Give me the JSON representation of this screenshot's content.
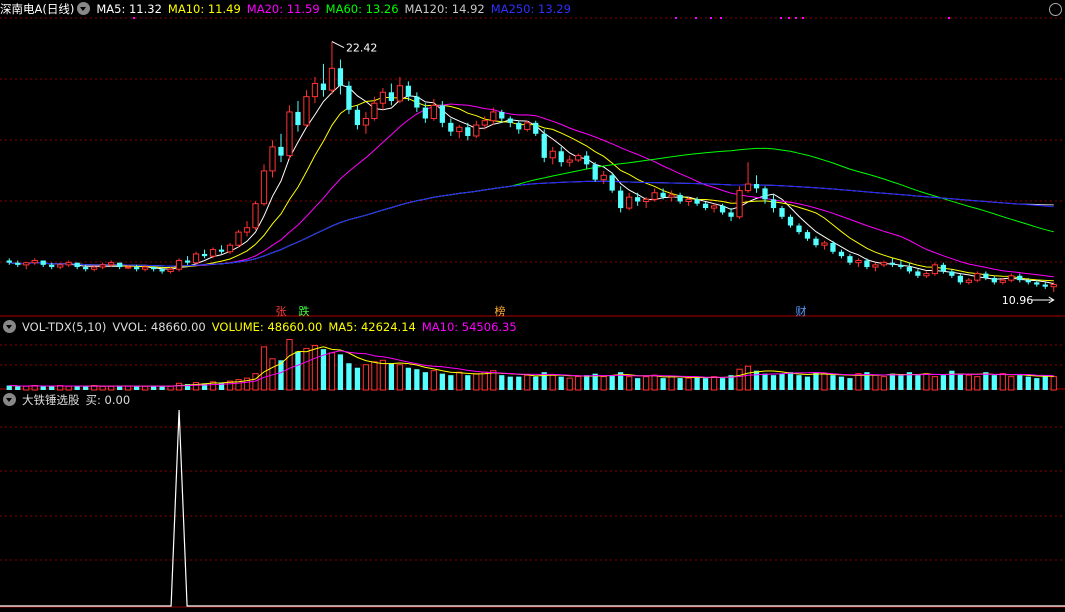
{
  "main_header": {
    "title": "深南电A(日线)",
    "ma5": "MA5: 11.32",
    "ma10": "MA10: 11.49",
    "ma20": "MA20: 11.59",
    "ma60": "MA60: 13.26",
    "ma120": "MA120: 14.92",
    "ma250": "MA250: 13.29"
  },
  "vol_header": {
    "name": "VOL-TDX(5,10)",
    "vvol": "VVOL: 48660.00",
    "volume": "VOLUME: 48660.00",
    "ma5": "MA5: 42624.14",
    "ma10": "MA10: 54506.35"
  },
  "ind_header": {
    "name": "大铁锤选股",
    "buy": "买: 0.00"
  },
  "price_labels": {
    "high": "22.42",
    "low": "10.96"
  },
  "markers": [
    "张",
    "跌",
    "榜",
    "财"
  ],
  "colors": {
    "up": "#ff3232",
    "down": "#54ffff",
    "ma5": "#ffffff",
    "ma10": "#ffff00",
    "ma20": "#ff00ff",
    "ma60": "#00ff00",
    "ma120": "#c8c8c8",
    "ma250": "#2020ff",
    "grid": "#8b0000",
    "magenta_dot": "#ff00ff"
  },
  "chart_data": {
    "type": "candlestick",
    "ohlc": [
      [
        12.4,
        12.5,
        12.2,
        12.3
      ],
      [
        12.3,
        12.4,
        12.1,
        12.2
      ],
      [
        12.2,
        12.3,
        12.0,
        12.3
      ],
      [
        12.3,
        12.5,
        12.2,
        12.4
      ],
      [
        12.4,
        12.4,
        12.1,
        12.2
      ],
      [
        12.2,
        12.3,
        12.0,
        12.1
      ],
      [
        12.1,
        12.3,
        12.0,
        12.2
      ],
      [
        12.2,
        12.4,
        12.1,
        12.3
      ],
      [
        12.3,
        12.3,
        12.0,
        12.1
      ],
      [
        12.1,
        12.2,
        11.9,
        12.0
      ],
      [
        12.0,
        12.2,
        11.9,
        12.1
      ],
      [
        12.1,
        12.3,
        12.0,
        12.2
      ],
      [
        12.2,
        12.4,
        12.1,
        12.3
      ],
      [
        12.3,
        12.3,
        12.0,
        12.1
      ],
      [
        12.1,
        12.2,
        12.0,
        12.1
      ],
      [
        12.1,
        12.2,
        11.9,
        12.0
      ],
      [
        12.0,
        12.2,
        11.9,
        12.1
      ],
      [
        12.1,
        12.1,
        11.9,
        12.0
      ],
      [
        12.0,
        12.1,
        11.8,
        11.9
      ],
      [
        11.9,
        12.1,
        11.8,
        12.0
      ],
      [
        12.0,
        12.5,
        11.9,
        12.4
      ],
      [
        12.4,
        12.6,
        12.2,
        12.3
      ],
      [
        12.3,
        12.8,
        12.2,
        12.7
      ],
      [
        12.7,
        12.9,
        12.5,
        12.6
      ],
      [
        12.6,
        13.0,
        12.5,
        12.9
      ],
      [
        12.9,
        13.1,
        12.7,
        12.8
      ],
      [
        12.8,
        13.2,
        12.7,
        13.1
      ],
      [
        13.1,
        13.8,
        13.0,
        13.7
      ],
      [
        13.7,
        14.2,
        13.5,
        13.9
      ],
      [
        13.9,
        15.1,
        13.8,
        15.0
      ],
      [
        15.0,
        16.8,
        14.9,
        16.5
      ],
      [
        16.5,
        17.9,
        16.2,
        17.6
      ],
      [
        17.6,
        18.2,
        16.9,
        17.2
      ],
      [
        17.2,
        19.5,
        17.0,
        19.2
      ],
      [
        19.2,
        19.7,
        18.3,
        18.6
      ],
      [
        18.6,
        20.2,
        18.5,
        19.9
      ],
      [
        19.9,
        20.8,
        19.6,
        20.5
      ],
      [
        20.5,
        21.4,
        19.9,
        20.2
      ],
      [
        20.2,
        22.42,
        20.0,
        21.2
      ],
      [
        21.2,
        21.6,
        20.0,
        20.4
      ],
      [
        20.4,
        20.6,
        19.1,
        19.3
      ],
      [
        19.3,
        19.5,
        18.4,
        18.6
      ],
      [
        18.6,
        19.2,
        18.2,
        18.9
      ],
      [
        18.9,
        19.9,
        18.8,
        19.6
      ],
      [
        19.6,
        20.3,
        19.3,
        20.1
      ],
      [
        20.1,
        20.5,
        19.5,
        19.7
      ],
      [
        19.7,
        20.8,
        19.6,
        20.4
      ],
      [
        20.4,
        20.6,
        19.7,
        19.9
      ],
      [
        19.9,
        20.1,
        19.2,
        19.4
      ],
      [
        19.4,
        19.6,
        18.7,
        18.9
      ],
      [
        18.9,
        19.8,
        18.8,
        19.5
      ],
      [
        19.5,
        19.7,
        18.5,
        18.7
      ],
      [
        18.7,
        18.9,
        18.1,
        18.3
      ],
      [
        18.3,
        18.6,
        18.0,
        18.5
      ],
      [
        18.5,
        18.7,
        17.9,
        18.1
      ],
      [
        18.1,
        18.8,
        18.0,
        18.6
      ],
      [
        18.6,
        19.0,
        18.4,
        18.8
      ],
      [
        18.8,
        19.4,
        18.6,
        19.2
      ],
      [
        19.2,
        19.3,
        18.7,
        18.9
      ],
      [
        18.9,
        19.0,
        18.5,
        18.7
      ],
      [
        18.7,
        18.8,
        18.2,
        18.4
      ],
      [
        18.4,
        18.8,
        18.3,
        18.7
      ],
      [
        18.7,
        18.8,
        18.1,
        18.2
      ],
      [
        18.2,
        18.4,
        16.9,
        17.1
      ],
      [
        17.1,
        17.6,
        16.8,
        17.4
      ],
      [
        17.4,
        17.6,
        16.7,
        16.9
      ],
      [
        16.9,
        17.2,
        16.7,
        17.0
      ],
      [
        17.0,
        17.3,
        16.9,
        17.2
      ],
      [
        17.2,
        17.4,
        16.6,
        16.8
      ],
      [
        16.8,
        16.9,
        16.0,
        16.1
      ],
      [
        16.1,
        16.5,
        15.9,
        16.3
      ],
      [
        16.3,
        16.4,
        15.5,
        15.6
      ],
      [
        15.6,
        15.8,
        14.6,
        14.8
      ],
      [
        14.8,
        15.5,
        14.7,
        15.3
      ],
      [
        15.3,
        15.5,
        14.9,
        15.1
      ],
      [
        15.1,
        15.3,
        14.8,
        15.2
      ],
      [
        15.2,
        15.7,
        15.1,
        15.5
      ],
      [
        15.5,
        15.7,
        15.2,
        15.3
      ],
      [
        15.3,
        15.6,
        15.1,
        15.4
      ],
      [
        15.4,
        15.5,
        15.0,
        15.1
      ],
      [
        15.1,
        15.3,
        14.9,
        15.2
      ],
      [
        15.2,
        15.3,
        14.9,
        15.0
      ],
      [
        15.0,
        15.1,
        14.7,
        14.8
      ],
      [
        14.8,
        15.0,
        14.6,
        14.9
      ],
      [
        14.9,
        15.0,
        14.5,
        14.6
      ],
      [
        14.6,
        14.8,
        14.2,
        14.4
      ],
      [
        14.4,
        15.8,
        14.3,
        15.6
      ],
      [
        15.6,
        16.9,
        15.5,
        15.9
      ],
      [
        15.9,
        16.3,
        15.5,
        15.7
      ],
      [
        15.7,
        15.8,
        15.0,
        15.2
      ],
      [
        15.2,
        15.4,
        14.6,
        14.8
      ],
      [
        14.8,
        14.9,
        14.3,
        14.4
      ],
      [
        14.4,
        14.5,
        13.9,
        14.0
      ],
      [
        14.0,
        14.1,
        13.6,
        13.7
      ],
      [
        13.7,
        13.8,
        13.3,
        13.4
      ],
      [
        13.4,
        13.5,
        13.0,
        13.1
      ],
      [
        13.1,
        13.3,
        12.9,
        13.2
      ],
      [
        13.2,
        13.3,
        12.7,
        12.8
      ],
      [
        12.8,
        12.9,
        12.5,
        12.6
      ],
      [
        12.6,
        12.7,
        12.2,
        12.3
      ],
      [
        12.3,
        12.5,
        12.1,
        12.4
      ],
      [
        12.4,
        12.5,
        12.0,
        12.1
      ],
      [
        12.1,
        12.3,
        11.9,
        12.2
      ],
      [
        12.2,
        12.4,
        12.1,
        12.3
      ],
      [
        12.3,
        12.5,
        12.1,
        12.2
      ],
      [
        12.2,
        12.4,
        12.0,
        12.1
      ],
      [
        12.1,
        12.3,
        11.8,
        11.9
      ],
      [
        11.9,
        12.0,
        11.6,
        11.7
      ],
      [
        11.7,
        11.9,
        11.6,
        11.8
      ],
      [
        11.8,
        12.3,
        11.7,
        12.2
      ],
      [
        12.2,
        12.3,
        11.8,
        11.9
      ],
      [
        11.9,
        12.0,
        11.6,
        11.7
      ],
      [
        11.7,
        11.8,
        11.3,
        11.4
      ],
      [
        11.4,
        11.6,
        11.3,
        11.5
      ],
      [
        11.5,
        11.9,
        11.4,
        11.8
      ],
      [
        11.8,
        11.9,
        11.5,
        11.6
      ],
      [
        11.6,
        11.7,
        11.3,
        11.4
      ],
      [
        11.4,
        11.6,
        11.3,
        11.5
      ],
      [
        11.5,
        11.8,
        11.4,
        11.7
      ],
      [
        11.7,
        11.8,
        11.4,
        11.5
      ],
      [
        11.5,
        11.6,
        11.3,
        11.4
      ],
      [
        11.4,
        11.5,
        11.2,
        11.3
      ],
      [
        11.3,
        11.4,
        11.1,
        11.2
      ],
      [
        11.2,
        11.4,
        10.96,
        11.3
      ]
    ],
    "volumes": [
      6,
      5,
      5,
      6,
      5,
      5,
      6,
      5,
      5,
      5,
      6,
      5,
      5,
      6,
      5,
      5,
      5,
      6,
      5,
      5,
      9,
      8,
      10,
      9,
      11,
      10,
      12,
      14,
      16,
      22,
      58,
      42,
      40,
      68,
      52,
      56,
      60,
      55,
      50,
      48,
      36,
      30,
      34,
      38,
      40,
      36,
      34,
      30,
      28,
      24,
      26,
      22,
      20,
      24,
      20,
      22,
      24,
      26,
      20,
      18,
      18,
      20,
      18,
      24,
      20,
      18,
      16,
      18,
      20,
      22,
      18,
      20,
      24,
      18,
      16,
      18,
      20,
      16,
      18,
      16,
      16,
      18,
      16,
      18,
      16,
      20,
      28,
      32,
      26,
      22,
      20,
      22,
      24,
      20,
      18,
      24,
      22,
      20,
      18,
      16,
      22,
      24,
      20,
      18,
      22,
      20,
      24,
      20,
      22,
      18,
      20,
      26,
      22,
      20,
      18,
      24,
      20,
      22,
      18,
      20,
      18,
      16,
      20,
      18
    ],
    "signal_index": 20,
    "ylim": [
      10.5,
      23.5
    ]
  }
}
